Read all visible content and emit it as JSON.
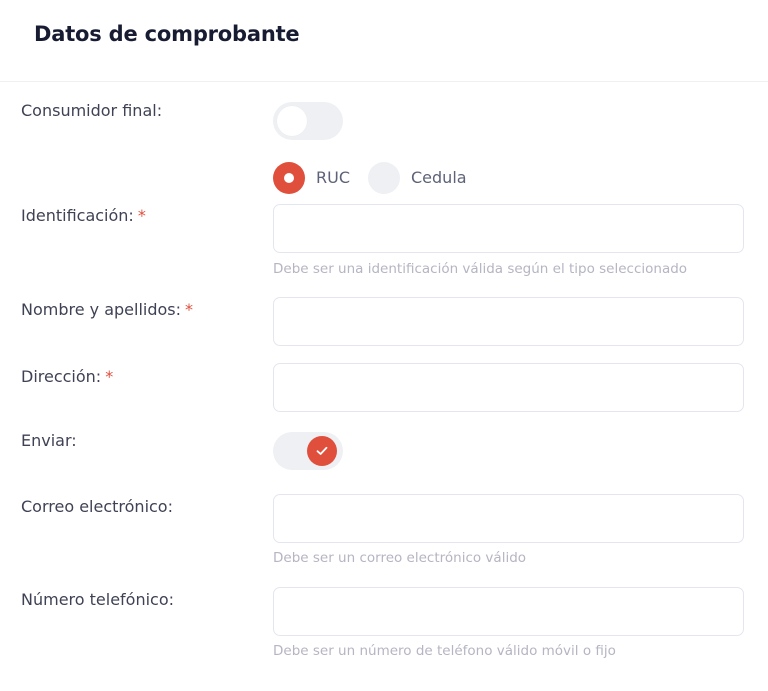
{
  "header": {
    "title": "Datos de comprobante"
  },
  "fields": {
    "consumidor_final": {
      "label": "Consumidor final:",
      "checked": false
    },
    "tipo_identificacion": {
      "options": [
        "RUC",
        "Cedula"
      ],
      "selected": "RUC"
    },
    "identificacion": {
      "label": "Identificación:",
      "required_mark": "*",
      "value": "",
      "hint": "Debe ser una identificación válida según el tipo seleccionado"
    },
    "nombre": {
      "label": "Nombre y apellidos:",
      "required_mark": "*",
      "value": ""
    },
    "direccion": {
      "label": "Dirección:",
      "required_mark": "*",
      "value": ""
    },
    "enviar": {
      "label": "Enviar:",
      "checked": true
    },
    "correo": {
      "label": "Correo electrónico:",
      "value": "",
      "hint": "Debe ser un correo electrónico válido"
    },
    "telefono": {
      "label": "Número telefónico:",
      "value": "",
      "hint": "Debe ser un número de teléfono válido móvil o fijo"
    }
  },
  "colors": {
    "accent": "#e04f3c",
    "switch_track": "#eef0f3",
    "hint_text": "#b5b5c3",
    "input_border": "#e4e6ef"
  },
  "icons": {
    "enviar_knob": "check-icon"
  }
}
